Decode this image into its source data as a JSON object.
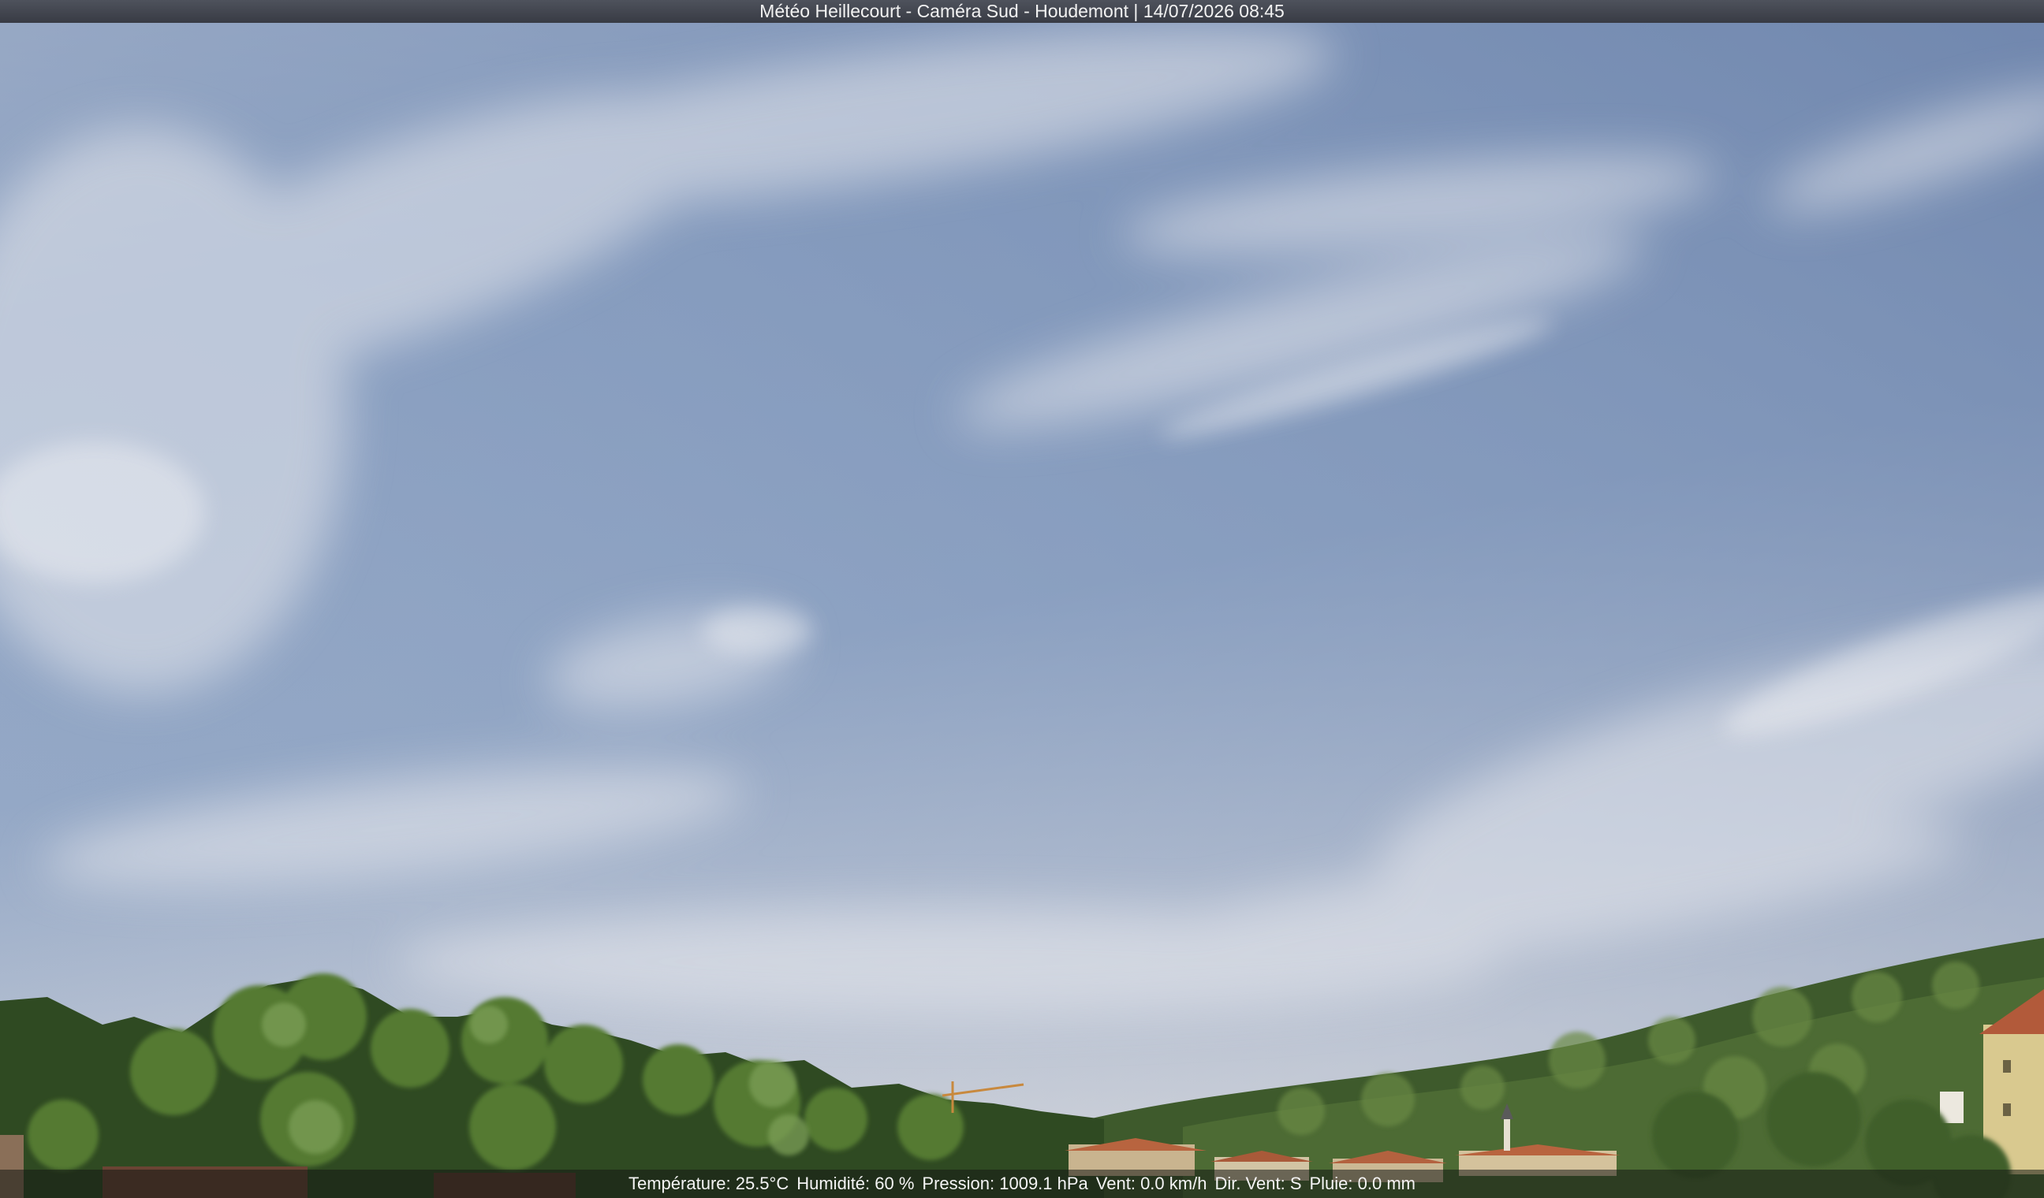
{
  "overlay": {
    "title": "Météo Heillecourt - Caméra Sud - Houdemont | 14/07/2026 08:45",
    "readings": {
      "temperature": "Température: 25.5°C",
      "humidity": "Humidité: 60 %",
      "pressure": "Pression: 1009.1 hPa",
      "wind_speed": "Vent: 0.0 km/h",
      "wind_direction": "Dir. Vent: S",
      "rain": "Pluie: 0.0 mm"
    }
  },
  "scene": {
    "subject": "webcam view of a summer morning sky with cirrus clouds over a wooded hillside and village rooftops",
    "colors": {
      "sky_top": "#6f86ad",
      "sky_mid": "#8fa5c6",
      "sky_horizon": "#d8d9de",
      "foliage_dark": "#2f4a22",
      "foliage_light": "#6f8f48",
      "roof": "#b8643f"
    }
  }
}
